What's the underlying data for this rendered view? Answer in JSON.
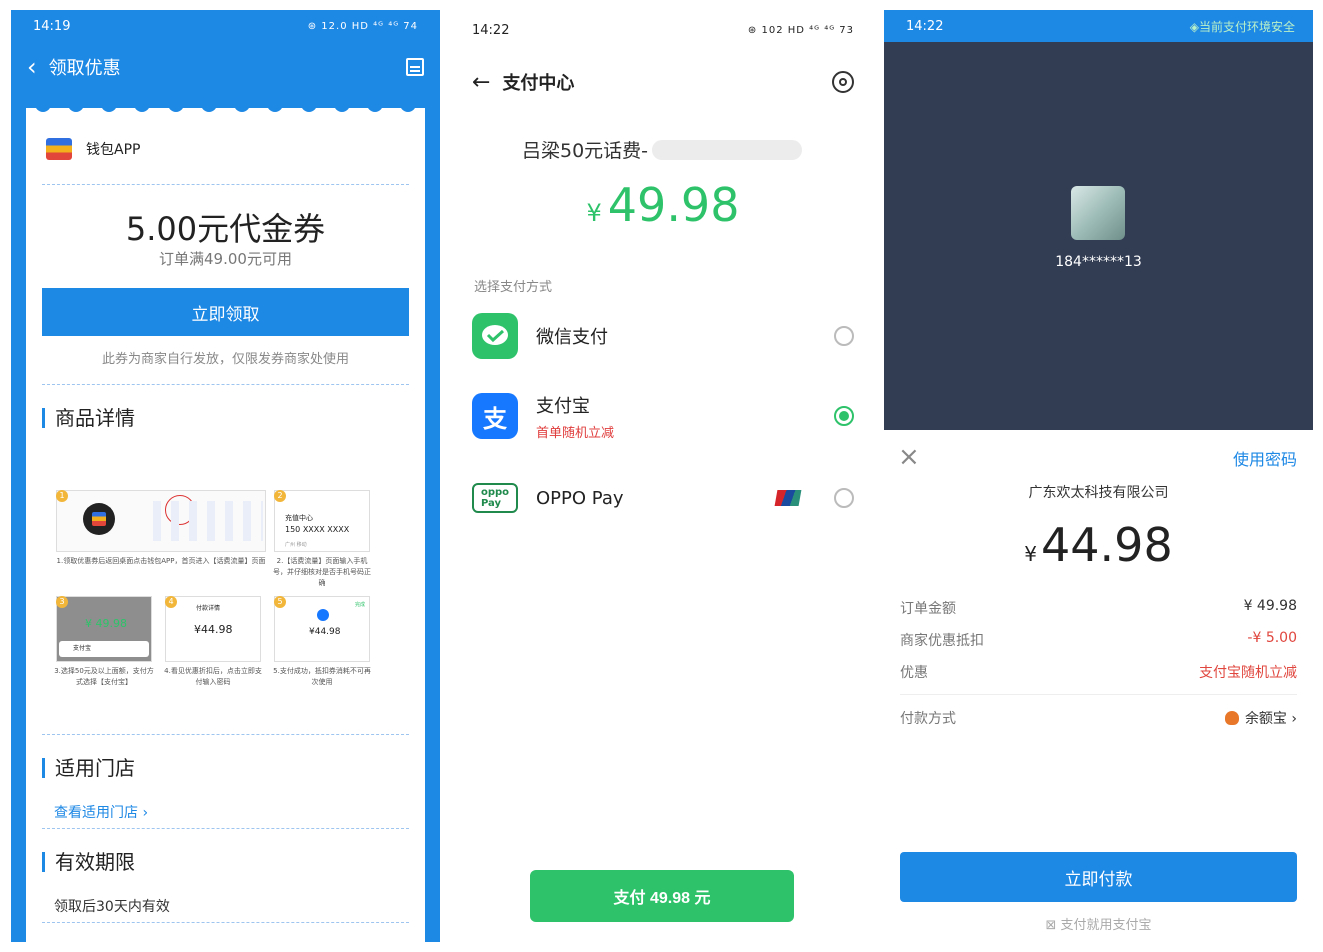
{
  "panel1": {
    "status": {
      "time": "14:19",
      "icons": "⊛ 12.0 HD ⁴ᴳ ⁴ᴳ 74"
    },
    "nav": {
      "back": "‹",
      "title": "领取优惠"
    },
    "merchant": "钱包APP",
    "coupon": {
      "amount": "5.00元代金券",
      "condition": "订单满49.00元可用",
      "claim_button": "立即领取",
      "note": "此券为商家自行发放，仅限发券商家处使用"
    },
    "details_title": "商品详情",
    "guide": {
      "step1": {
        "num": "1",
        "caption": "1.领取优惠券后返回桌面点击钱包APP，首页进入【话费流量】页面"
      },
      "step2": {
        "num": "2",
        "heading": "充值中心",
        "phone": "150 XXXX XXXX",
        "carrier": "广州 移动",
        "caption": "2.【话费流量】页面输入手机号，并仔细核对是否手机号码正确"
      },
      "step3": {
        "num": "3",
        "price": "¥ 49.98",
        "method": "支付宝",
        "caption": "3.选择50元及以上面额，支付方式选择【支付宝】"
      },
      "step4": {
        "num": "4",
        "heading": "付款详情",
        "price": "¥44.98",
        "caption": "4.看见优惠折扣后，点击立即支付输入密码"
      },
      "step5": {
        "num": "5",
        "status": "完成",
        "price": "¥44.98",
        "caption": "5.支付成功，抵扣券消耗不可再次使用"
      }
    },
    "stores_title": "适用门店",
    "stores_link": "查看适用门店 ›",
    "validity_title": "有效期限",
    "validity_text": "领取后30天内有效"
  },
  "panel2": {
    "status": {
      "time": "14:22",
      "icons": "⊛ 102 HD ⁴ᴳ ⁴ᴳ 73"
    },
    "nav": {
      "back": "←",
      "title": "支付中心"
    },
    "product": "吕梁50元话费-",
    "price": {
      "currency": "¥",
      "value": "49.98"
    },
    "method_label": "选择支付方式",
    "methods": [
      {
        "name": "微信支付",
        "promo": "",
        "selected": false,
        "icon": "wechat-pay-icon",
        "color": "#2ec36a"
      },
      {
        "name": "支付宝",
        "promo": "首单随机立减",
        "selected": true,
        "icon": "alipay-icon",
        "color": "#1677ff"
      },
      {
        "name": "OPPO Pay",
        "promo": "",
        "selected": false,
        "icon": "oppo-pay-icon",
        "color": "#1f8a4c"
      }
    ],
    "pay_button": "支付 49.98 元"
  },
  "panel3": {
    "status": {
      "time": "14:22",
      "secure": "当前支付环境安全"
    },
    "account": "184******13",
    "close": "×",
    "use_password": "使用密码",
    "company": "广东欢太科技有限公司",
    "amount": {
      "currency": "¥",
      "value": "44.98"
    },
    "rows": [
      {
        "label": "订单金额",
        "value": "¥ 49.98"
      },
      {
        "label": "商家优惠抵扣",
        "value": "-¥ 5.00"
      },
      {
        "label": "优惠",
        "value": "支付宝随机立减"
      }
    ],
    "pay_method": {
      "label": "付款方式",
      "value": "余额宝 ›"
    },
    "pay_button": "立即付款",
    "footer": "支付就用支付宝"
  }
}
